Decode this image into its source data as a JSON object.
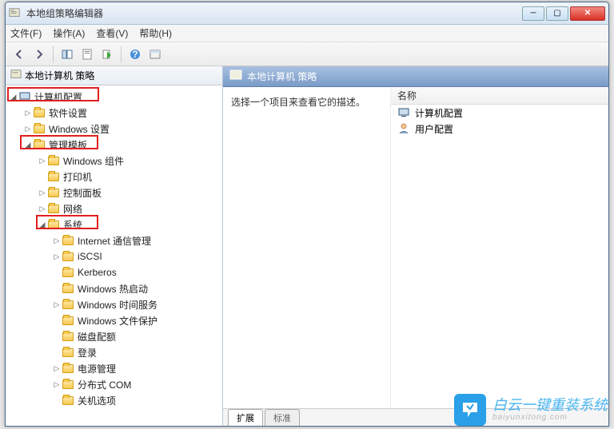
{
  "window": {
    "title": "本地组策略编辑器"
  },
  "menu": {
    "file": "文件(F)",
    "action": "操作(A)",
    "view": "查看(V)",
    "help": "帮助(H)"
  },
  "left": {
    "root": "本地计算机 策略",
    "computerConfig": "计算机配置",
    "softwareSettings": "软件设置",
    "windowsSettings": "Windows 设置",
    "adminTemplates": "管理模板",
    "windowsComponents": "Windows 组件",
    "printers": "打印机",
    "controlPanel": "控制面板",
    "network": "网络",
    "system": "系统",
    "internetComm": "Internet 通信管理",
    "iscsi": "iSCSI",
    "kerberos": "Kerberos",
    "winHotStart": "Windows 热启动",
    "winTimeService": "Windows 时间服务",
    "winFileProtection": "Windows 文件保护",
    "diskQuotas": "磁盘配额",
    "logon": "登录",
    "powerMgmt": "电源管理",
    "dcom": "分布式 COM",
    "shutdownOptions": "关机选项"
  },
  "right": {
    "header": "本地计算机 策略",
    "hint": "选择一个项目来查看它的描述。",
    "colName": "名称",
    "item1": "计算机配置",
    "item2": "用户配置",
    "tabExtended": "扩展",
    "tabStandard": "标准"
  },
  "watermark": {
    "cn": "白云一键重装系统",
    "en": "baiyunxitong.com"
  }
}
